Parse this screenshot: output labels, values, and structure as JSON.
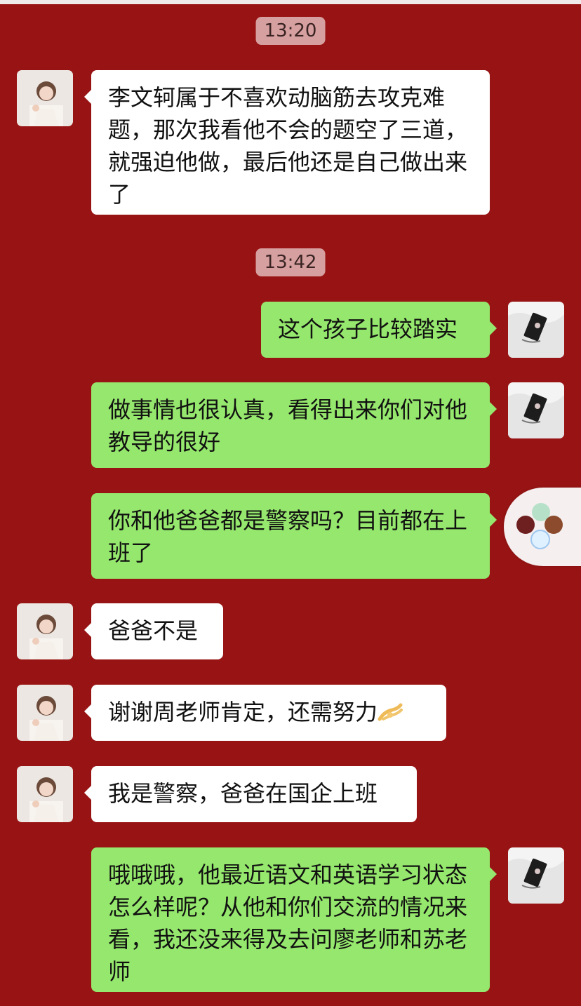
{
  "chat": {
    "timestamps": [
      "13:20",
      "13:42"
    ],
    "messages": [
      {
        "side": "left",
        "text": "李文轲属于不喜欢动脑筋去攻克难题，那次我看他不会的题空了三道，就强迫他做，最后他还是自己做出来了"
      },
      {
        "side": "right",
        "text": "这个孩子比较踏实"
      },
      {
        "side": "right",
        "text": "做事情也很认真，看得出来你们对他教导的很好"
      },
      {
        "side": "right",
        "text": "你和他爸爸都是警察吗？目前都在上班了"
      },
      {
        "side": "left",
        "text": "爸爸不是"
      },
      {
        "side": "left",
        "text": "谢谢周老师肯定，还需努力"
      },
      {
        "side": "left",
        "text": "我是警察，爸爸在国企上班"
      },
      {
        "side": "right",
        "text": "哦哦哦，他最近语文和英语学习状态怎么样呢？从他和你们交流的情况来看，我还没来得及去问廖老师和苏老师"
      }
    ],
    "emoji": "ok-hand-emoji"
  },
  "colors": {
    "background": "#981414",
    "incoming_bubble": "#ffffff",
    "outgoing_bubble": "#95e76d",
    "timestamp_bg": "#d7a0a0"
  }
}
